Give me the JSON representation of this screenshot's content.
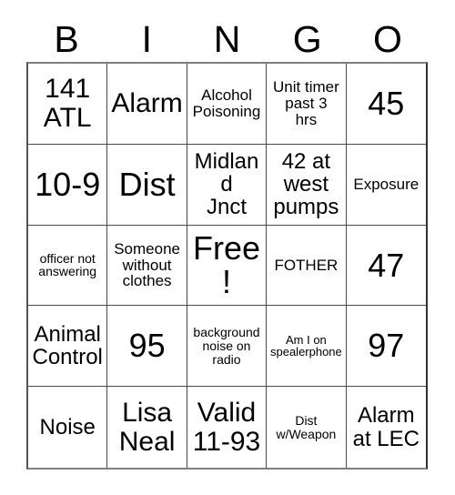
{
  "card": {
    "title": "BINGO",
    "header_letters": [
      "B",
      "I",
      "N",
      "G",
      "O"
    ],
    "free_space_label": "Free!",
    "colors": {
      "background": "#ffffff",
      "text": "#000000",
      "grid_line": "#4a4a4a",
      "border": "#555555"
    },
    "columns": 5,
    "rows": 5,
    "cells": [
      {
        "text": "141\nATL",
        "size": "s-lg"
      },
      {
        "text": "Alarm",
        "size": "s-lg"
      },
      {
        "text": "Alcohol\nPoisoning",
        "size": "s-sm"
      },
      {
        "text": "Unit timer\npast 3\nhrs",
        "size": "s-sm"
      },
      {
        "text": "45",
        "size": "s-xl"
      },
      {
        "text": "10-9",
        "size": "s-xl"
      },
      {
        "text": "Dist",
        "size": "s-xl"
      },
      {
        "text": "Midland\nJnct",
        "size": "s-md"
      },
      {
        "text": "42 at\nwest\npumps",
        "size": "s-md"
      },
      {
        "text": "Exposure",
        "size": "s-sm"
      },
      {
        "text": "officer not\nanswering",
        "size": "s-xs"
      },
      {
        "text": "Someone\nwithout\nclothes",
        "size": "s-sm"
      },
      {
        "text": "Free!",
        "size": "s-xl"
      },
      {
        "text": "FOTHER",
        "size": "s-sm"
      },
      {
        "text": "47",
        "size": "s-xl"
      },
      {
        "text": "Animal\nControl",
        "size": "s-md"
      },
      {
        "text": "95",
        "size": "s-xl"
      },
      {
        "text": "background\nnoise on\nradio",
        "size": "s-xs"
      },
      {
        "text": "Am I on\nspealerphone",
        "size": "s-xxs"
      },
      {
        "text": "97",
        "size": "s-xl"
      },
      {
        "text": "Noise",
        "size": "s-md"
      },
      {
        "text": "Lisa\nNeal",
        "size": "s-lg"
      },
      {
        "text": "Valid\n11-93",
        "size": "s-lg"
      },
      {
        "text": "Dist\nw/Weapon",
        "size": "s-xs"
      },
      {
        "text": "Alarm\nat LEC",
        "size": "s-md"
      }
    ]
  }
}
